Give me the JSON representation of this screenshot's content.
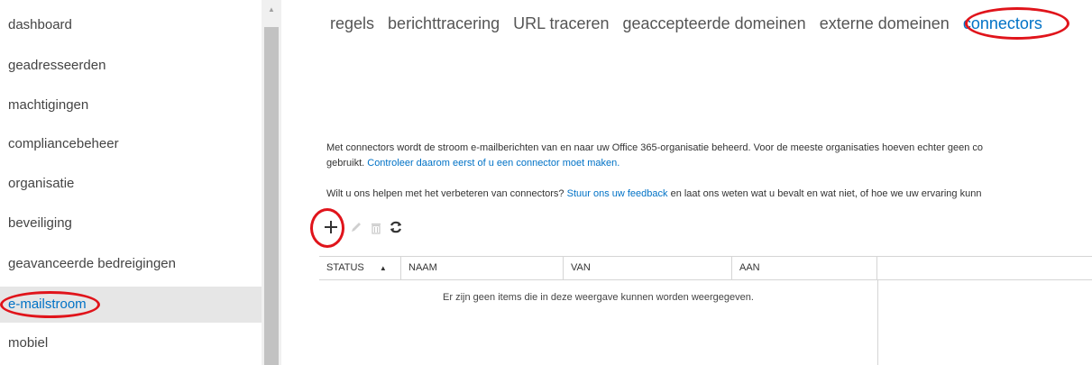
{
  "sidebar": {
    "items": [
      {
        "label": "dashboard"
      },
      {
        "label": "geadresseerden"
      },
      {
        "label": "machtigingen"
      },
      {
        "label": "compliancebeheer"
      },
      {
        "label": "organisatie"
      },
      {
        "label": "beveiliging"
      },
      {
        "label": "geavanceerde bedreigingen"
      },
      {
        "label": "e-mailstroom",
        "active": true
      },
      {
        "label": "mobiel"
      }
    ]
  },
  "tabs": [
    {
      "label": "regels"
    },
    {
      "label": "berichttracering"
    },
    {
      "label": "URL traceren"
    },
    {
      "label": "geaccepteerde domeinen"
    },
    {
      "label": "externe domeinen"
    },
    {
      "label": "connectors",
      "active": true
    }
  ],
  "description": {
    "line1": "Met connectors wordt de stroom e-mailberichten van en naar uw Office 365-organisatie beheerd. Voor de meeste organisaties hoeven echter geen co",
    "line2_prefix": "gebruikt. ",
    "line2_link": "Controleer daarom eerst of u een connector moet maken.",
    "feedback_prefix": "Wilt u ons helpen met het verbeteren van connectors? ",
    "feedback_link": "Stuur ons uw feedback",
    "feedback_suffix": " en laat ons weten wat u bevalt en wat niet, of hoe we uw ervaring kunn"
  },
  "toolbar": {
    "icons": [
      "add-icon",
      "edit-icon",
      "delete-icon",
      "refresh-icon"
    ]
  },
  "grid": {
    "columns": [
      "STATUS",
      "NAAM",
      "VAN",
      "AAN"
    ],
    "sort_indicator": "▲",
    "empty_message": "Er zijn geen items die in deze weergave kunnen worden weergegeven."
  },
  "colors": {
    "accent": "#0072c6",
    "annotation": "#e0141b",
    "active_nav_bg": "#e6e6e6"
  }
}
